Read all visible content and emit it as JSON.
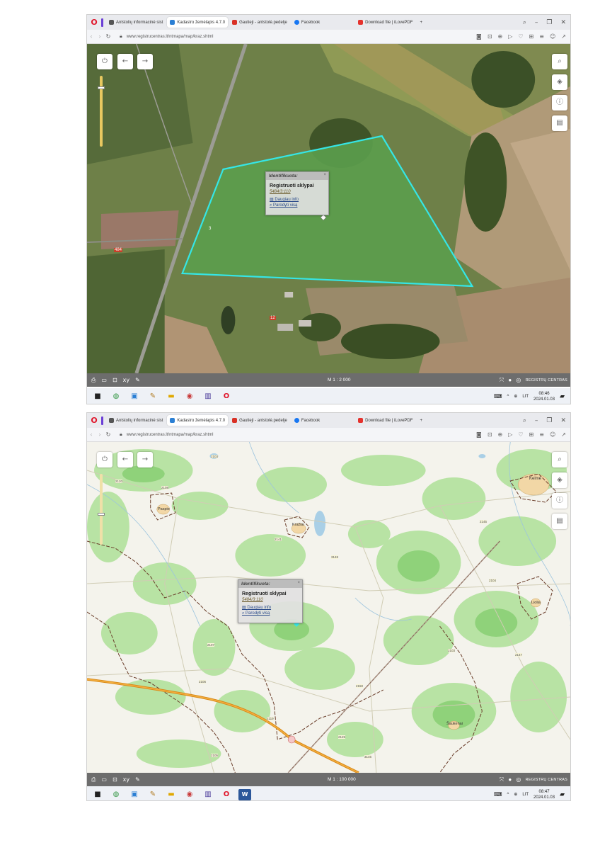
{
  "browser": {
    "opera_glyph": "O",
    "tabs": [
      {
        "label": "Antstolių informacinė sist",
        "active": false,
        "icon": "page-icon",
        "color": "#555555"
      },
      {
        "label": "Kadastro žemėlapis 4.7.0",
        "active": true,
        "icon": "map-icon",
        "color": "#2b7fd4"
      },
      {
        "label": "Gautieji - antstolė.pedelje",
        "active": false,
        "icon": "gmail-icon",
        "color": "#d93025"
      },
      {
        "label": "Facebook",
        "active": false,
        "icon": "facebook-icon",
        "color": "#1877f2"
      },
      {
        "label": "Download file | iLovePDF",
        "active": false,
        "icon": "pdf-icon",
        "color": "#e5322d"
      }
    ],
    "new_tab": "+",
    "url": "www.registrucentras.lt/ntmapa/map/kraz.shtml"
  },
  "screen1": {
    "popup": {
      "header": "Identifikuota:",
      "title": "Registruoti sklypai",
      "parcel_id": "5484/3:110",
      "more_info": "Daugiau info",
      "show_all": "Parodyti visą"
    },
    "map_labels": {
      "field_number": "3",
      "road_marker": "484",
      "farm_marker": "12"
    },
    "scale": "M 1 : 2 000",
    "brand": "REGISTRŲ CENTRAS",
    "clock_time": "08:46",
    "clock_date": "2024.01.03",
    "lang": "LIT",
    "zoom_level": 0.85
  },
  "screen2": {
    "popup": {
      "header": "Identifikuota:",
      "title": "Registruoti sklypai",
      "parcel_id": "5484/3:110",
      "more_info": "Daugiau info",
      "show_all": "Parodyti visą"
    },
    "place_names": {
      "kelme": "Kelmė",
      "paspiai": "Paspie",
      "kraziai": "Kražiai",
      "lioliai": "Liolia",
      "saukenai": "Šaukenai"
    },
    "road_numbers": {
      "r1": "2103",
      "r2": "2120",
      "r3": "2108",
      "r4": "2141",
      "r5": "3148",
      "r6": "2145",
      "r7": "2104",
      "r8": "2107",
      "r9": "2106",
      "r10": "2150",
      "r11": "2119",
      "r12": "2103",
      "r13": "2147",
      "r14": "2125",
      "r15": "2105",
      "r16": "3146"
    },
    "scale": "M 1 : 100 000",
    "brand": "REGISTRŲ CENTRAS",
    "clock_time": "08:47",
    "clock_date": "2024.01.03",
    "lang": "LIT",
    "zoom_level": 0.45
  },
  "colors": {
    "parcel_outline": "#35e6e6",
    "accent": "#6b3fd6",
    "opera_red": "#e0162b"
  }
}
